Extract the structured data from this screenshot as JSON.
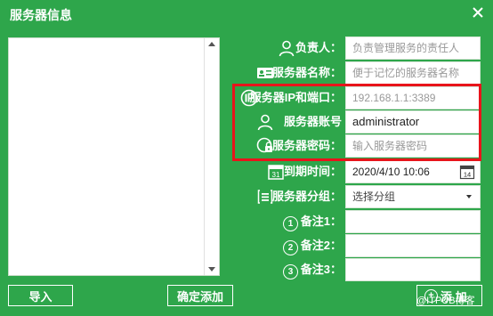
{
  "window": {
    "title": "服务器信息"
  },
  "buttons": {
    "import": "导入",
    "confirm_add": "确定添加",
    "add": "添 加"
  },
  "form": {
    "owner": {
      "label": "负责人：",
      "placeholder": "负责管理服务的责任人"
    },
    "server_name": {
      "label": "服务器名称：",
      "placeholder": "便于记忆的服务器名称"
    },
    "ip_port": {
      "label": "服务器IP和端口：",
      "placeholder": "192.168.1.1:3389"
    },
    "account": {
      "label": "服务器账号",
      "value": "administrator"
    },
    "password": {
      "label": "服务器密码：",
      "placeholder": "输入服务器密码"
    },
    "expire": {
      "label": "到期时间：",
      "value": "2020/4/10 10:06",
      "calendar_day": "14",
      "icon_day": "31"
    },
    "group": {
      "label": "服务器分组：",
      "value": "选择分组"
    },
    "note1": {
      "label": "备注1：",
      "num": "1"
    },
    "note2": {
      "label": "备注2：",
      "num": "2"
    },
    "note3": {
      "label": "备注3：",
      "num": "3"
    }
  },
  "watermark": "@ITPUB博客",
  "colors": {
    "background": "#2ea64b",
    "highlight": "#e8141b"
  }
}
